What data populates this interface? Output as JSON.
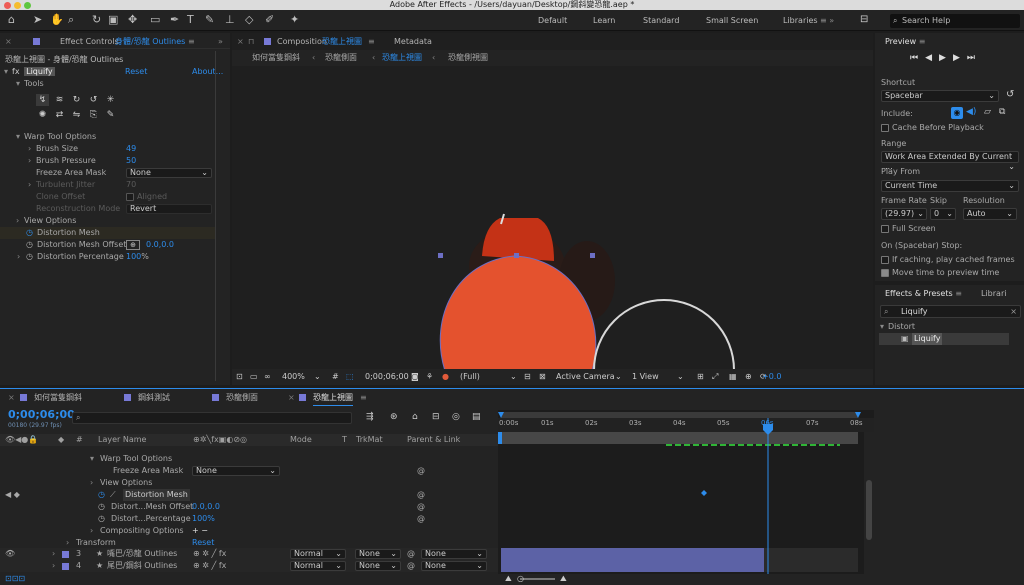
{
  "window": {
    "title": "Adobe After Effects - /Users/dayuan/Desktop/鋼斜變恐龍.aep *"
  },
  "toolbar": {
    "workspaces": [
      "Default",
      "Learn",
      "Standard",
      "Small Screen",
      "Libraries"
    ],
    "active_workspace": "Libraries",
    "search_placeholder": "Search Help"
  },
  "effect_controls": {
    "tab_label": "Effect Controls",
    "tab_layer": "身體/恐龍 Outlines",
    "subtitle": "恐龍上視圖 - 身體/恐龍 Outlines",
    "fx_name": "Liquify",
    "reset": "Reset",
    "about": "About...",
    "tools_label": "Tools",
    "warp_tool_options": "Warp Tool Options",
    "brush_size_label": "Brush Size",
    "brush_size_value": "49",
    "brush_pressure_label": "Brush Pressure",
    "brush_pressure_value": "50",
    "freeze_area_mask_label": "Freeze Area Mask",
    "freeze_area_mask_value": "None",
    "turbulent_jitter_label": "Turbulent Jitter",
    "turbulent_jitter_value": "70",
    "clone_offset_label": "Clone Offset",
    "aligned_label": "Aligned",
    "reconstruction_mode_label": "Reconstruction Mode",
    "reconstruction_mode_value": "Revert",
    "view_options": "View Options",
    "distortion_mesh": "Distortion Mesh",
    "distortion_mesh_offset": "Distortion Mesh Offset",
    "distortion_mesh_offset_value": "0.0,0.0",
    "distortion_percentage": "Distortion Percentage",
    "distortion_percentage_value": "100",
    "percent_sign": "%"
  },
  "composition": {
    "tab_label": "Composition",
    "tab_comp": "恐龍上視圖",
    "metadata_tab": "Metadata",
    "breadcrumbs": [
      "如何當隻鋼斜",
      "恐龍側面",
      "恐龍上視圖",
      "恐龍側視圖"
    ],
    "active_breadcrumb": "恐龍上視圖",
    "zoom": "400%",
    "timecode": "0;00;06;00",
    "resolution": "(Full)",
    "camera": "Active Camera",
    "views": "1 View",
    "exposure": "+0.0"
  },
  "preview": {
    "title": "Preview",
    "shortcut_label": "Shortcut",
    "shortcut_value": "Spacebar",
    "include_label": "Include:",
    "cache_before_playback": "Cache Before Playback",
    "range_label": "Range",
    "range_value": "Work Area Extended By Current ...",
    "play_from_label": "Play From",
    "play_from_value": "Current Time",
    "frame_rate_label": "Frame Rate",
    "skip_label": "Skip",
    "resolution_label": "Resolution",
    "frame_rate_value": "(29.97)",
    "skip_value": "0",
    "resolution_value": "Auto",
    "full_screen": "Full Screen",
    "on_stop_label": "On (Spacebar) Stop:",
    "if_caching": "If caching, play cached frames",
    "move_time": "Move time to preview time",
    "cache_checked": false,
    "full_screen_checked": false,
    "if_caching_checked": false,
    "move_time_checked": true
  },
  "effects_presets": {
    "tab_label": "Effects & Presets",
    "libraries_tab": "Librari",
    "search_value": "Liquify",
    "category": "Distort",
    "result": "Liquify"
  },
  "timeline": {
    "tabs": [
      "如何當隻鋼斜",
      "鋼斜測試",
      "恐龍側面",
      "恐龍上視圖"
    ],
    "active_tab": "恐龍上視圖",
    "timecode": "0;00;06;00",
    "frame_info": "00180 (29.97 fps)",
    "col_hash": "#",
    "col_layer_name": "Layer Name",
    "col_mode": "Mode",
    "col_t": "T",
    "col_trkmat": "TrkMat",
    "col_parent": "Parent & Link",
    "ruler_labels": [
      "0:00s",
      "01s",
      "02s",
      "03s",
      "04s",
      "05s",
      "06s",
      "07s",
      "08s"
    ],
    "rows": {
      "warp_tool_options": "Warp Tool Options",
      "freeze_area_mask": "Freeze Area Mask",
      "freeze_value": "None",
      "view_options": "View Options",
      "distortion_mesh": "Distortion Mesh",
      "mesh_offset": "Distort...Mesh Offset",
      "mesh_offset_value": "0.0,0.0",
      "percentage": "Distort...Percentage",
      "percentage_value": "100%",
      "compositing_options": "Compositing Options",
      "compositing_plus_minus": "+ −",
      "transform": "Transform",
      "transform_reset": "Reset"
    },
    "layers": [
      {
        "num": "3",
        "name": "嘴巴/恐龍 Outlines",
        "mode": "Normal",
        "trkmat": "None",
        "parent": "None"
      },
      {
        "num": "4",
        "name": "尾巴/鋼斜 Outlines",
        "mode": "Normal",
        "trkmat": "None",
        "parent": "None"
      }
    ]
  },
  "colors": {
    "accent": "#2d8ceb",
    "body_orange": "#e4522e",
    "head_red": "#c43216",
    "layer_bar": "#5c62a6",
    "label_purple": "#7779d6"
  }
}
